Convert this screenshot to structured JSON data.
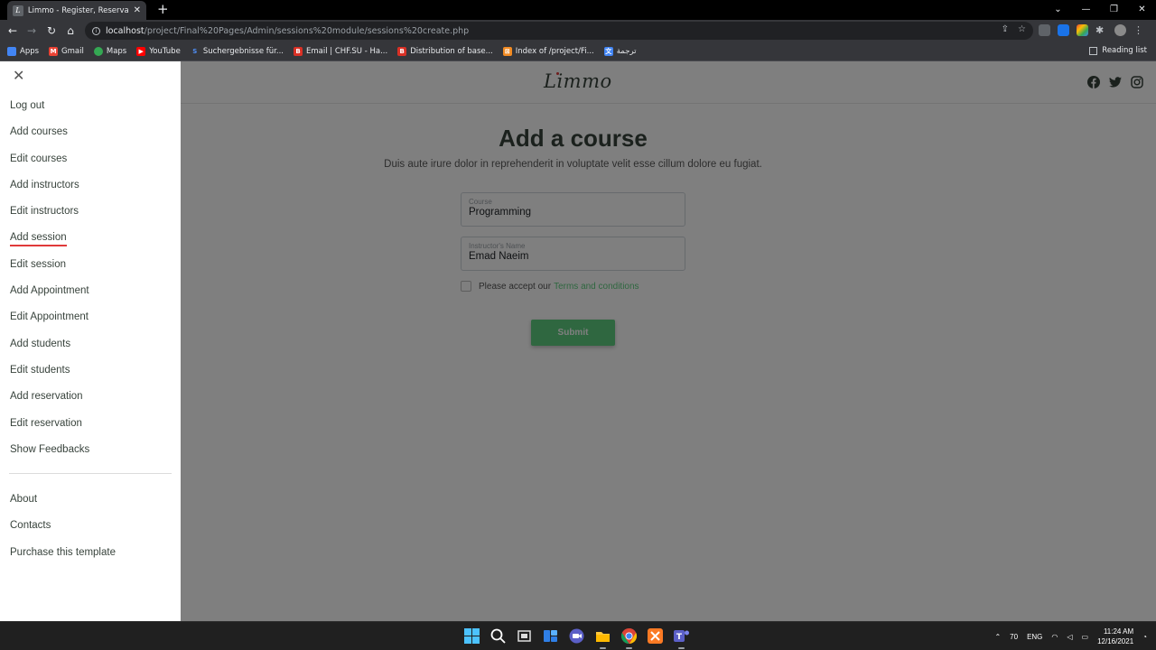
{
  "browser": {
    "tab_title": "Limmo - Register, Reservation, C",
    "tab_favicon_letter": "L",
    "url_host": "localhost",
    "url_path": "/project/Final%20Pages/Admin/sessions%20module/sessions%20create.php",
    "bookmarks": [
      {
        "label": "Apps",
        "icon": "apps-grid-icon",
        "color": "#4285f4"
      },
      {
        "label": "Gmail",
        "icon": "gmail-icon",
        "color": "#ea4335"
      },
      {
        "label": "Maps",
        "icon": "maps-pin-icon",
        "color": "#34a853"
      },
      {
        "label": "YouTube",
        "icon": "youtube-icon",
        "color": "#ff0000"
      },
      {
        "label": "Suchergebnisse für...",
        "icon": "s-icon",
        "color": "#1a73e8"
      },
      {
        "label": "Email | CHF.SU - Ha...",
        "icon": "b-icon",
        "color": "#d93025"
      },
      {
        "label": "Distribution of base...",
        "icon": "b-icon",
        "color": "#d93025"
      },
      {
        "label": "Index of /project/Fi...",
        "icon": "xampp-icon",
        "color": "#f28b22"
      },
      {
        "label": "ترجمة",
        "icon": "translate-icon",
        "color": "#4285f4"
      }
    ],
    "reading_list": "Reading list"
  },
  "site": {
    "logo": "Limmo",
    "accent_color": "#5fcf80",
    "social_icons": [
      "facebook-icon",
      "twitter-icon",
      "instagram-icon"
    ]
  },
  "form": {
    "title": "Add a course",
    "subtitle": "Duis aute irure dolor in reprehenderit in voluptate velit esse cillum dolore eu fugiat.",
    "course_label": "Course",
    "course_value": "Programming",
    "instructor_label": "Instructor's Name",
    "instructor_value": "Emad Naeim",
    "terms_prefix": "Please accept our",
    "terms_link": "Terms and conditions",
    "submit_label": "Submit"
  },
  "sidenav": {
    "items": [
      {
        "label": "Log out",
        "active": false
      },
      {
        "label": "Add courses",
        "active": false
      },
      {
        "label": "Edit courses",
        "active": false
      },
      {
        "label": "Add instructors",
        "active": false
      },
      {
        "label": "Edit instructors",
        "active": false
      },
      {
        "label": "Add session",
        "active": true
      },
      {
        "label": "Edit session",
        "active": false
      },
      {
        "label": "Add Appointment",
        "active": false
      },
      {
        "label": "Edit Appointment",
        "active": false
      },
      {
        "label": "Add students",
        "active": false
      },
      {
        "label": "Edit students",
        "active": false
      },
      {
        "label": "Add reservation",
        "active": false
      },
      {
        "label": "Edit reservation",
        "active": false
      },
      {
        "label": "Show Feedbacks",
        "active": false
      }
    ],
    "secondary_items": [
      {
        "label": "About"
      },
      {
        "label": "Contacts"
      },
      {
        "label": "Purchase this template"
      }
    ]
  },
  "taskbar": {
    "weather": "70",
    "language": "ENG",
    "time": "11:24 AM",
    "date": "12/16/2021"
  }
}
